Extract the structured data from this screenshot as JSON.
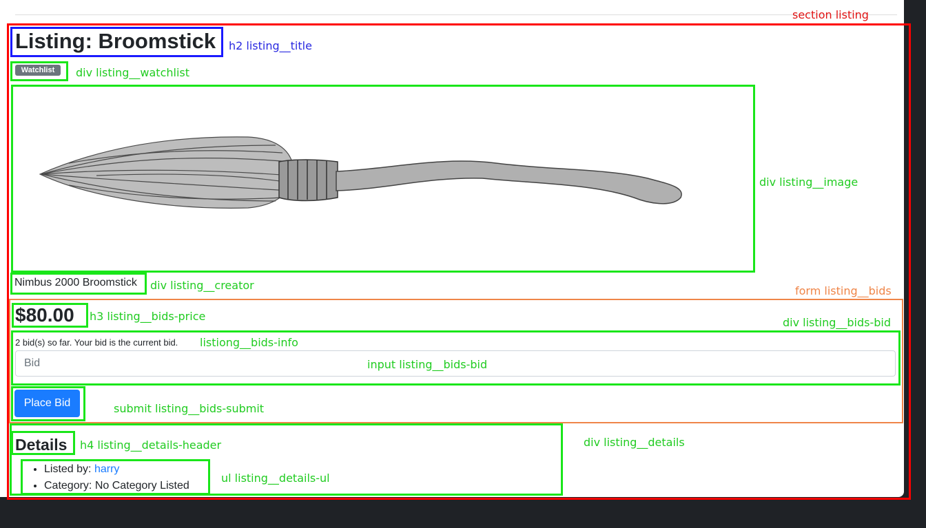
{
  "listing": {
    "title": "Listing: Broomstick",
    "watchlist_label": "Watchlist",
    "image_alt": "broomstick-illustration",
    "creator": "Nimbus 2000 Broomstick",
    "price": "$80.00",
    "bids_info": "2 bid(s) so far. Your bid is the current bid.",
    "bid_placeholder": "Bid",
    "submit_label": "Place Bid",
    "details": {
      "header": "Details",
      "listed_by_label": "Listed by: ",
      "listed_by_user": "harry",
      "category": "Category: No Category Listed"
    }
  },
  "annotations": {
    "section": "section listing",
    "title": "h2 listing__title",
    "watchlist": "div listing__watchlist",
    "image": "div listing__image",
    "creator": "div listing__creator",
    "form": "form listing__bids",
    "price": "h3 listing__bids-price",
    "bids_bid": "div listing__bids-bid",
    "bids_info": "listiong__bids-info",
    "input": "input listing__bids-bid",
    "submit": "submit listing__bids-submit",
    "details_header": "h4 listing__details-header",
    "details": "div listing__details",
    "details_ul": "ul listing__details-ul"
  },
  "colors": {
    "section": "#ff0000",
    "title_box": "#1a1aff",
    "component": "#1ae61a",
    "form": "#ef8548",
    "primary_button": "#1a7cff",
    "badge": "#6c757d",
    "background": "#1f2226"
  }
}
